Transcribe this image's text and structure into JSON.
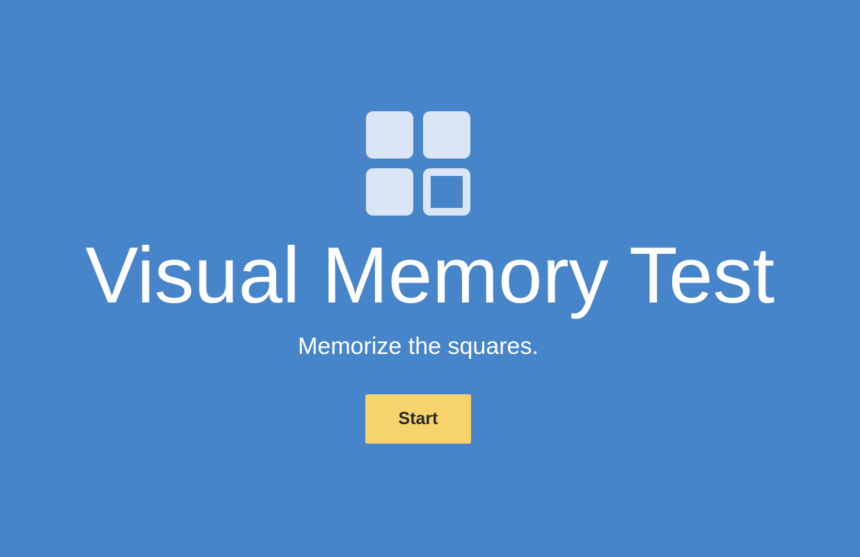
{
  "colors": {
    "background": "#4785cb",
    "logo_squares": "#dae5f5",
    "button_bg": "#f7d36d",
    "button_text": "#2a2a2a",
    "text": "#ffffff"
  },
  "logo": {
    "icon": "memory-grid-icon"
  },
  "title": "Visual Memory Test",
  "subtitle": "Memorize the squares.",
  "start_button": {
    "label": "Start"
  }
}
